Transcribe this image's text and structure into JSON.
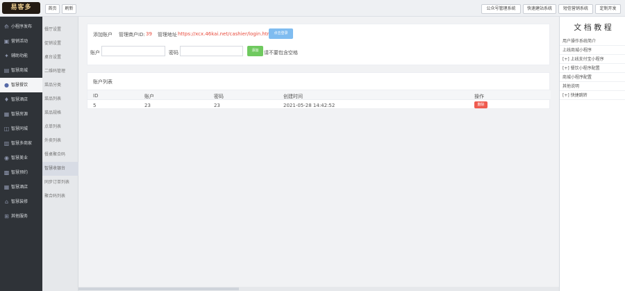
{
  "brand": {
    "logo_text": "易客多"
  },
  "top_tabs": {
    "home": "首页",
    "refresh": "刷新"
  },
  "top_systems": [
    "公众号管理系统",
    "快速建站系统",
    "短信营销系统",
    "定制开发"
  ],
  "sidebar": {
    "items": [
      {
        "label": "小程序发布",
        "icon": "send-icon"
      },
      {
        "label": "营销活动",
        "icon": "gift-icon"
      },
      {
        "label": "辅助功能",
        "icon": "key-icon"
      },
      {
        "label": "智慧商城",
        "icon": "shop-icon"
      },
      {
        "label": "智慧餐饮",
        "icon": "food-icon"
      },
      {
        "label": "智慧酒店",
        "icon": "drink-icon"
      },
      {
        "label": "智慧房源",
        "icon": "house-icon"
      },
      {
        "label": "智慧同城",
        "icon": "city-icon"
      },
      {
        "label": "智慧多商家",
        "icon": "store-icon"
      },
      {
        "label": "智慧美业",
        "icon": "beauty-icon"
      },
      {
        "label": "智慧预约",
        "icon": "calendar-icon"
      },
      {
        "label": "智慧酒店",
        "icon": "hotel-icon"
      },
      {
        "label": "智慧装修",
        "icon": "decor-icon"
      },
      {
        "label": "其他服务",
        "icon": "grid-icon"
      }
    ]
  },
  "subnav": {
    "items": [
      "餐厅设置",
      "促销设置",
      "桌台设置",
      "二维码管理",
      "菜品分类",
      "菜品列表",
      "菜品规格",
      "点单列表",
      "外卖列表",
      "餐桌聚合码",
      "智慧收银台",
      "同步订单列表",
      "聚合码列表"
    ]
  },
  "form": {
    "add_account": "添加账户",
    "merchant_id_label": "管理商户ID:",
    "merchant_id_value": "39",
    "manage_url_label": "管理地址",
    "manage_url_value": "https://xcx.46kai.net/cashier/login.html",
    "login_button": "点击登录",
    "account_label": "账户",
    "password_label": "密码",
    "add_button": "添加",
    "hint": "请不要包含空格"
  },
  "account_list": {
    "title": "账户列表",
    "headers": [
      "ID",
      "账户",
      "密码",
      "创建时间",
      "操作"
    ],
    "rows": [
      [
        "5",
        "23",
        "23",
        "2021-05-28 14:42:52"
      ]
    ],
    "delete_button": "删除"
  },
  "docs": {
    "title": "文 档 教 程",
    "items": [
      "用户操作系统简介",
      "上线商城小程序",
      "[+] 上线支付宝小程序",
      "[+] 餐饮小程序配置",
      "商城小程序配置",
      "其他说明",
      "[+] 快捷跳转"
    ]
  },
  "colors": {
    "sidebar": "#2f3338",
    "accent_red": "#e84b3d",
    "accent_green": "#6fc95f",
    "accent_blue": "#7fbcf0"
  }
}
